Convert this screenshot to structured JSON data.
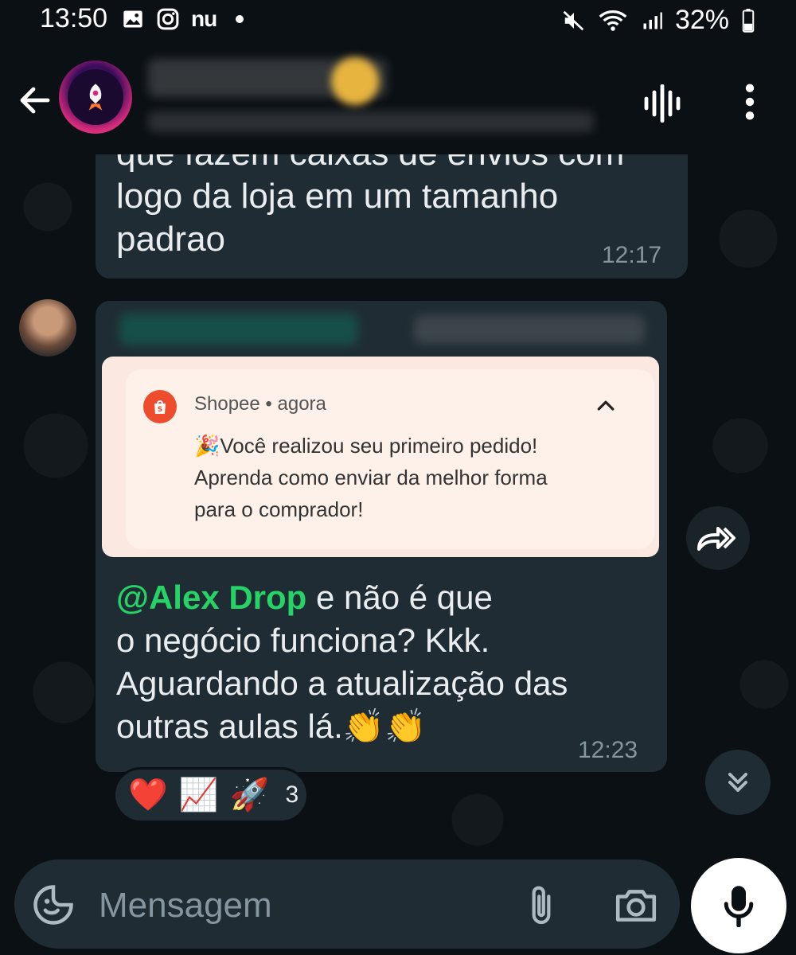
{
  "status_bar": {
    "time": "13:50",
    "left_icons": [
      "gallery-icon",
      "instagram-icon",
      "nubank-icon",
      "dot-icon"
    ],
    "nu_label": "nu",
    "right_icons": [
      "mute-icon",
      "wifi-icon",
      "signal-icon",
      "battery-icon"
    ],
    "battery": "32%"
  },
  "header": {
    "icons": [
      "back-arrow-icon",
      "group-avatar",
      "waveform-icon",
      "more-vert-icon"
    ]
  },
  "messages": [
    {
      "text_lines": [
        "que fazem caixas de envios com",
        "logo da loja em um tamanho",
        "padrao"
      ],
      "time": "12:17"
    },
    {
      "notification": {
        "app": "Shopee",
        "separator": " • ",
        "age": "agora",
        "line1": "🎉Você realizou seu primeiro pedido!",
        "line2": "Aprenda como enviar da melhor forma",
        "line3": "para o comprador!"
      },
      "mention": "@Alex Drop",
      "text_after_mention": " e não é que",
      "text_lines": [
        "o negócio funciona? Kkk.",
        "Aguardando a atualização das",
        "outras aulas lá.👏👏"
      ],
      "time": "12:23",
      "reactions": {
        "emojis": [
          "❤️",
          "📈",
          "🚀"
        ],
        "count": "3"
      }
    }
  ],
  "input_bar": {
    "placeholder": "Mensagem"
  },
  "colors": {
    "background": "#0b1014",
    "bubble": "#1f2c33",
    "mention": "#25d366",
    "secondary_text": "#8696a0",
    "shopee": "#ee4d2d"
  }
}
